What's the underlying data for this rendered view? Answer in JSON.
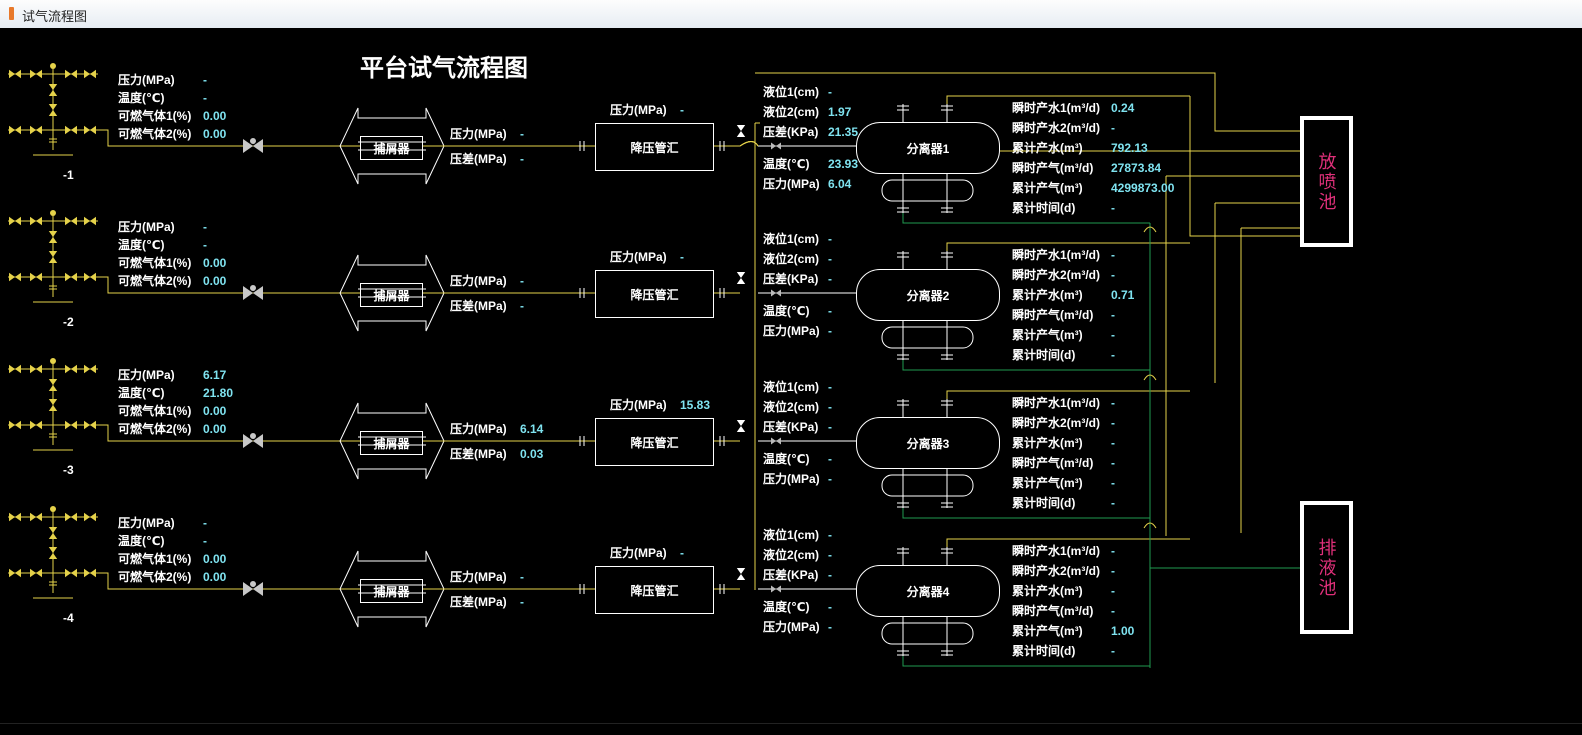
{
  "window": {
    "title": "试气流程图"
  },
  "page_title": "平台试气流程图",
  "colors": {
    "pipe_yellow": "#e5d24a",
    "pipe_green": "#1f9a4f",
    "value_cyan": "#7fe3f0",
    "pool_text": "#e0307a"
  },
  "labels": {
    "pressure": "压力(MPa)",
    "temperature": "温度(℃)",
    "gas1": "可燃气体1(%)",
    "gas2": "可燃气体2(%)",
    "diff_pressure": "压差(MPa)",
    "level1": "液位1(cm)",
    "level2": "液位2(cm)",
    "diff_kpa": "压差(KPa)",
    "water1": "瞬时产水1(m³/d)",
    "water2": "瞬时产水2(m³/d)",
    "cum_water": "累计产水(m³)",
    "inst_gas": "瞬时产气(m³/d)",
    "cum_gas": "累计产气(m³)",
    "cum_time": "累计时间(d)",
    "trap": "捕屑器",
    "manifold": "降压管汇"
  },
  "pools": {
    "vent": "放喷池",
    "drain": "排液池"
  },
  "wells": [
    {
      "id": "-1",
      "pressure": "-",
      "temperature": "-",
      "gas1": "0.00",
      "gas2": "0.00",
      "trap_pressure": "-",
      "trap_diff": "-",
      "manifold_pressure": "-",
      "sep_name": "分离器1",
      "level1": "-",
      "level2": "1.97",
      "diff_kpa": "21.35",
      "sep_temp": "23.93",
      "sep_pressure": "6.04",
      "water1": "0.24",
      "water2": "-",
      "cum_water": "792.13",
      "inst_gas": "27873.84",
      "cum_gas": "4299873.00",
      "cum_time": "-"
    },
    {
      "id": "-2",
      "pressure": "-",
      "temperature": "-",
      "gas1": "0.00",
      "gas2": "0.00",
      "trap_pressure": "-",
      "trap_diff": "-",
      "manifold_pressure": "-",
      "sep_name": "分离器2",
      "level1": "-",
      "level2": "-",
      "diff_kpa": "-",
      "sep_temp": "-",
      "sep_pressure": "-",
      "water1": "-",
      "water2": "-",
      "cum_water": "0.71",
      "inst_gas": "-",
      "cum_gas": "-",
      "cum_time": "-"
    },
    {
      "id": "-3",
      "pressure": "6.17",
      "temperature": "21.80",
      "gas1": "0.00",
      "gas2": "0.00",
      "trap_pressure": "6.14",
      "trap_diff": "0.03",
      "manifold_pressure": "15.83",
      "sep_name": "分离器3",
      "level1": "-",
      "level2": "-",
      "diff_kpa": "-",
      "sep_temp": "-",
      "sep_pressure": "-",
      "water1": "-",
      "water2": "-",
      "cum_water": "-",
      "inst_gas": "-",
      "cum_gas": "-",
      "cum_time": "-"
    },
    {
      "id": "-4",
      "pressure": "-",
      "temperature": "-",
      "gas1": "0.00",
      "gas2": "0.00",
      "trap_pressure": "-",
      "trap_diff": "-",
      "manifold_pressure": "-",
      "sep_name": "分离器4",
      "level1": "-",
      "level2": "-",
      "diff_kpa": "-",
      "sep_temp": "-",
      "sep_pressure": "-",
      "water1": "-",
      "water2": "-",
      "cum_water": "-",
      "inst_gas": "-",
      "cum_gas": "1.00",
      "cum_time": "-"
    }
  ]
}
